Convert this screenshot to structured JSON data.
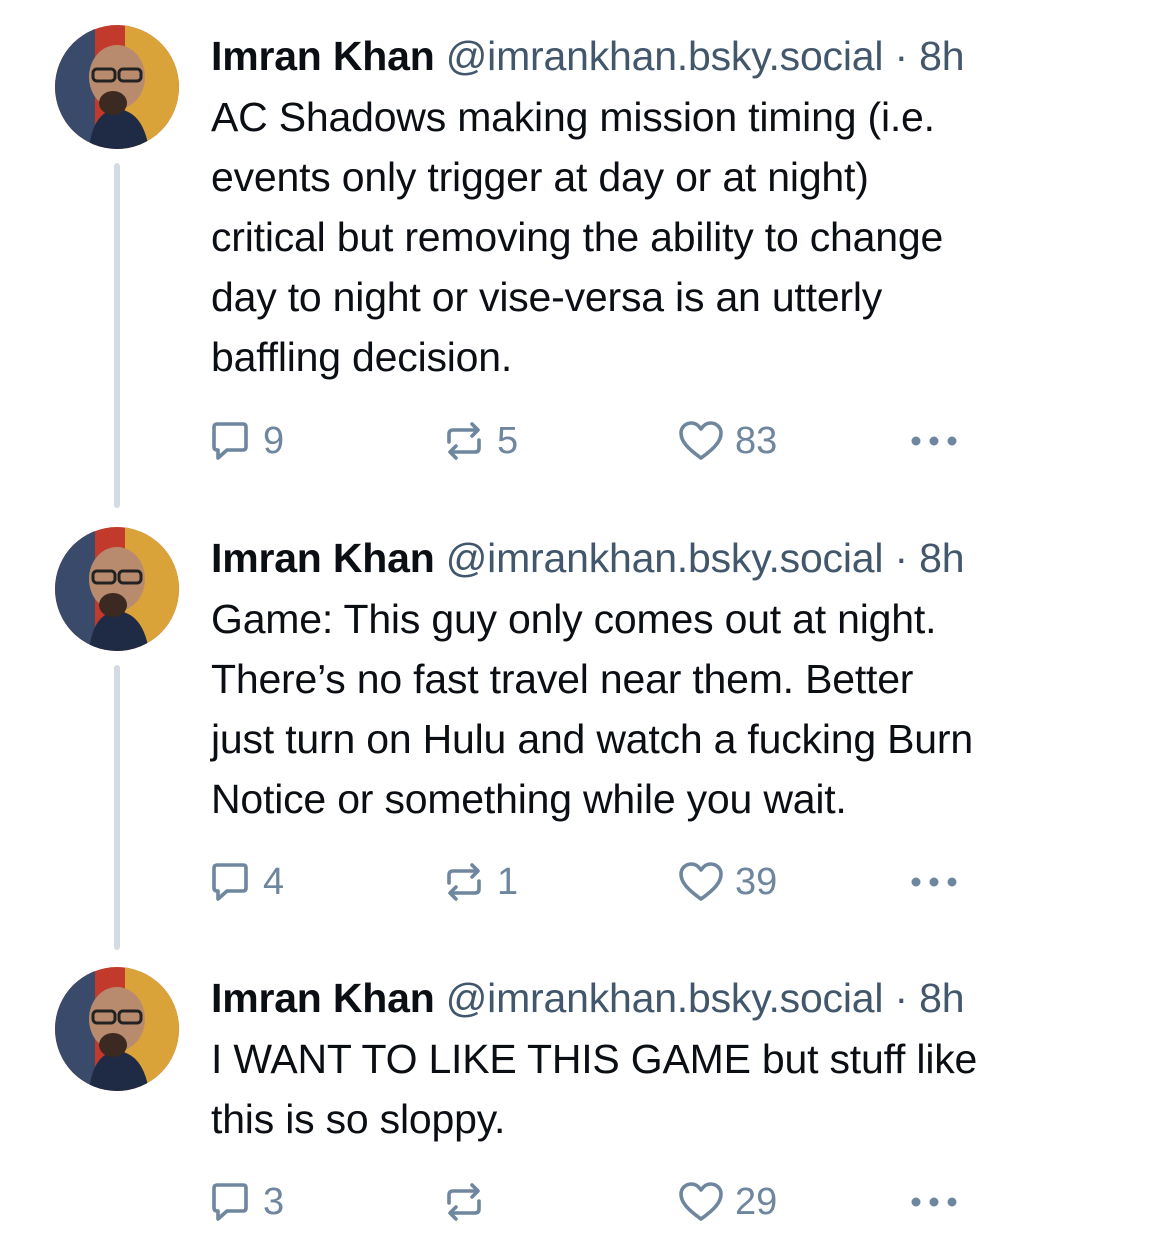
{
  "posts": [
    {
      "author_name": "Imran Khan",
      "handle": "@imrankhan.bsky.social",
      "separator": "·",
      "time": "8h",
      "lines": [
        "AC Shadows making mission timing (i.e.",
        "events only trigger at day or at night)",
        "critical but removing the ability to change",
        "day to night or vise-versa is an utterly",
        "baffling decision."
      ],
      "replies": "9",
      "reposts": "5",
      "likes": "83"
    },
    {
      "author_name": "Imran Khan",
      "handle": "@imrankhan.bsky.social",
      "separator": "·",
      "time": "8h",
      "lines": [
        "Game: This guy only comes out at night.",
        "There’s no fast travel near them. Better",
        "just turn on Hulu and watch a fucking Burn",
        "Notice or something while you wait."
      ],
      "replies": "4",
      "reposts": "1",
      "likes": "39"
    },
    {
      "author_name": "Imran Khan",
      "handle": "@imrankhan.bsky.social",
      "separator": "·",
      "time": "8h",
      "lines": [
        "I WANT TO LIKE THIS GAME but stuff like",
        "this is so sloppy."
      ],
      "replies": "3",
      "reposts": "",
      "likes": "29"
    }
  ],
  "icons": {
    "reply": "speech-bubble-icon",
    "repost": "repost-arrows-icon",
    "like": "heart-outline-icon",
    "more": "ellipsis-icon"
  },
  "colors": {
    "text_primary": "#0b0f14",
    "text_secondary": "#42576c",
    "icon_muted": "#6f869f",
    "thread_line": "#d4dbe2",
    "background": "#ffffff"
  }
}
